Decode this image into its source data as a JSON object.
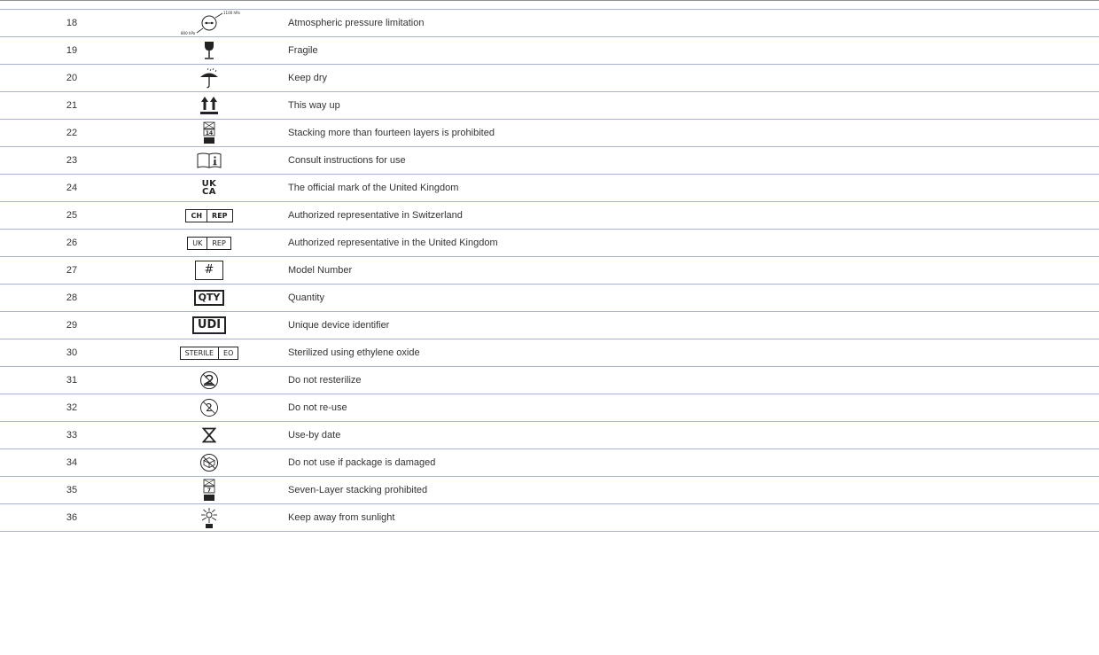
{
  "rows": [
    {
      "num": "18",
      "icon": "atmospheric-pressure-icon",
      "desc": "Atmospheric pressure limitation",
      "icon_text": {
        "upper": "1100 hPa",
        "lower": "800 hPa"
      }
    },
    {
      "num": "19",
      "icon": "fragile-icon",
      "desc": "Fragile"
    },
    {
      "num": "20",
      "icon": "keep-dry-icon",
      "desc": "Keep dry"
    },
    {
      "num": "21",
      "icon": "this-way-up-icon",
      "desc": "This way up"
    },
    {
      "num": "22",
      "icon": "stacking-limit-icon",
      "desc": "Stacking more than fourteen layers is prohibited",
      "icon_text": {
        "limit": "14"
      }
    },
    {
      "num": "23",
      "icon": "consult-instructions-icon",
      "desc": "Consult instructions for use"
    },
    {
      "num": "24",
      "icon": "ukca-mark-icon",
      "desc": "The official mark of the United Kingdom",
      "icon_text": {
        "top": "UK",
        "bottom": "CA"
      }
    },
    {
      "num": "25",
      "icon": "ch-rep-icon",
      "desc": "Authorized representative in Switzerland",
      "icon_text": {
        "left": "CH",
        "right": "REP"
      }
    },
    {
      "num": "26",
      "icon": "uk-rep-icon",
      "desc": "Authorized representative in the United Kingdom",
      "icon_text": {
        "left": "UK",
        "right": "REP"
      }
    },
    {
      "num": "27",
      "icon": "model-number-icon",
      "desc": "Model Number",
      "icon_text": {
        "label": "#"
      }
    },
    {
      "num": "28",
      "icon": "quantity-icon",
      "desc": "Quantity",
      "icon_text": {
        "label": "QTY"
      }
    },
    {
      "num": "29",
      "icon": "udi-icon",
      "desc": "Unique device identifier",
      "icon_text": {
        "label": "UDI"
      }
    },
    {
      "num": "30",
      "icon": "sterile-eo-icon",
      "desc": "Sterilized using ethylene oxide",
      "icon_text": {
        "left": "STERILE",
        "right": "EO"
      }
    },
    {
      "num": "31",
      "icon": "do-not-resterilize-icon",
      "desc": "Do not resterilize"
    },
    {
      "num": "32",
      "icon": "do-not-reuse-icon",
      "desc": "Do not re-use",
      "icon_text": {
        "label": "2"
      }
    },
    {
      "num": "33",
      "icon": "use-by-date-icon",
      "desc": "Use-by date"
    },
    {
      "num": "34",
      "icon": "do-not-use-if-damaged-icon",
      "desc": "Do not use if package is damaged"
    },
    {
      "num": "35",
      "icon": "stacking-limit-icon",
      "desc": "Seven-Layer stacking prohibited",
      "icon_text": {
        "limit": "7"
      }
    },
    {
      "num": "36",
      "icon": "keep-away-from-sunlight-icon",
      "desc": "Keep away from sunlight"
    }
  ]
}
